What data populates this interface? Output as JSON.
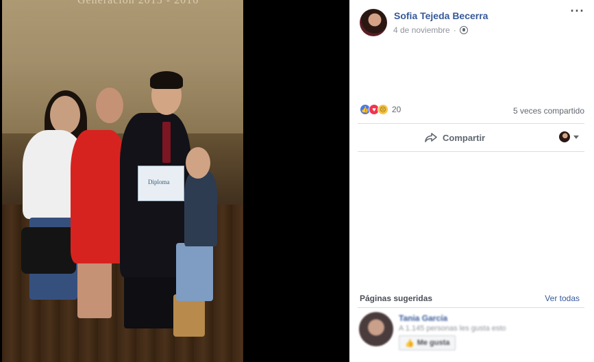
{
  "photo": {
    "screen_text": "Generación 2013 - 2016",
    "diploma_text": "Diploma"
  },
  "post": {
    "author": "Sofia Tejeda Becerra",
    "date": "4 de noviembre",
    "privacy_icon": "globe-icon",
    "reactions": {
      "types": [
        "like",
        "love",
        "sad"
      ],
      "count": "20"
    },
    "shares": "5 veces compartido",
    "share_label": "Compartir"
  },
  "suggested": {
    "title": "Páginas sugeridas",
    "see_all": "Ver todas",
    "item": {
      "name": "Tania García",
      "meta": "A 1.145 personas les gusta esto",
      "like_label": "Me gusta"
    }
  },
  "colors": {
    "link": "#365899",
    "like": "#4a79e8",
    "love": "#f0354f",
    "sad": "#f7c544"
  }
}
